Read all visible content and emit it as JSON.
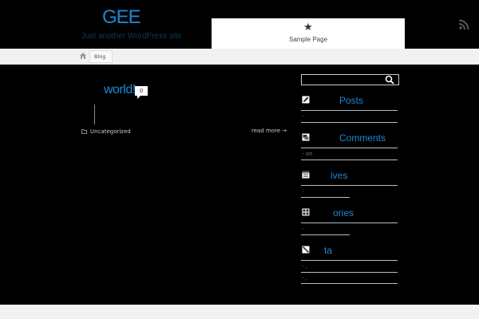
{
  "header": {
    "site_title": "GEE",
    "site_description": "Just another WordPress site",
    "nav_item": "Sample Page",
    "nav_icon": "star-icon",
    "feed_icon": "rss-icon"
  },
  "breadcrumb": {
    "home_icon": "home-icon",
    "current": "Blog"
  },
  "post": {
    "title": "world!",
    "comment_count": "0",
    "category": "Uncategorized",
    "read_more": "read more →"
  },
  "sidebar": {
    "search_icon": "search-icon",
    "widgets": [
      {
        "title": "Posts",
        "icon": "pencil-icon",
        "items": [
          "-"
        ]
      },
      {
        "title": "Comments",
        "icon": "comments-icon",
        "items": [
          "- on"
        ]
      },
      {
        "title": "ives",
        "icon": "calendar-icon",
        "items": [
          "-"
        ]
      },
      {
        "title": "ories",
        "icon": "categories-icon",
        "items": [
          "-"
        ]
      },
      {
        "title": "ta",
        "icon": "meta-icon",
        "items": [
          "- ,",
          "- ,"
        ]
      }
    ],
    "comment_item_text": "on",
    "meta_sep": ","
  },
  "colors": {
    "accent": "#1e87d2",
    "background": "#000000",
    "bar": "#f1f1f1"
  }
}
